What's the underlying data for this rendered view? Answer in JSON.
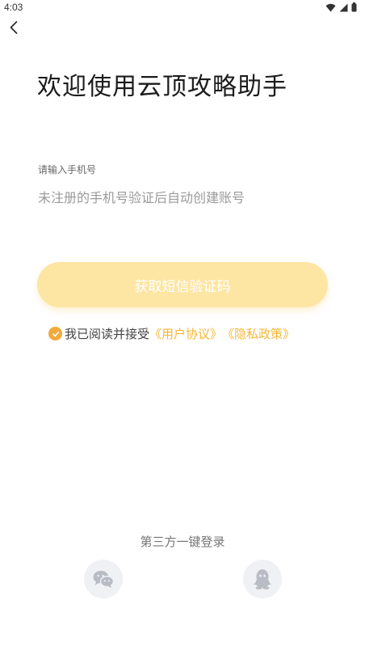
{
  "status_bar": {
    "time": "4:03"
  },
  "header": {
    "title": "欢迎使用云顶攻略助手"
  },
  "login_form": {
    "phone_label": "请输入手机号",
    "phone_placeholder": "未注册的手机号验证后自动创建账号",
    "phone_value": "",
    "sms_button_label": "获取短信验证码"
  },
  "agreement": {
    "checked": true,
    "text": "我已阅读并接受",
    "user_agreement_link": "《用户协议》",
    "privacy_policy_link": "《隐私政策》"
  },
  "third_party": {
    "label": "第三方一键登录",
    "providers": [
      {
        "icon": "wechat-icon"
      },
      {
        "icon": "qq-icon"
      }
    ]
  },
  "colors": {
    "accent": "#f5b735",
    "button_bg": "#fde5a3",
    "check_bg": "#f2a93b",
    "social_bg": "#f0f1f4"
  }
}
